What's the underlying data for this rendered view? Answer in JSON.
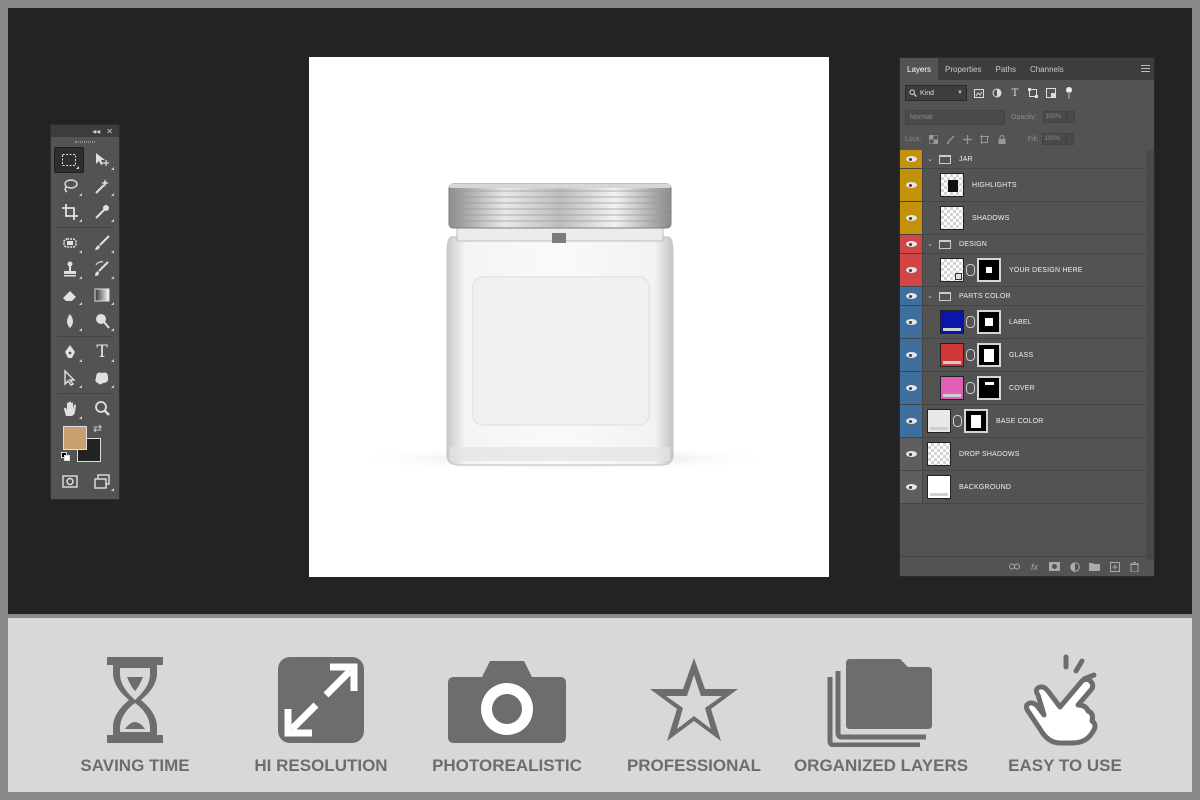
{
  "colors": {
    "workspace": "#232323",
    "panel": "#535353",
    "group_jar": "#c4920a",
    "group_design": "#d04646",
    "group_parts": "#3e6e9c",
    "group_default": "#5e5e5e",
    "feature_gray": "#6d6d6d",
    "foreground_swatch": "#c8a070",
    "background_swatch": "#222222"
  },
  "toolbox": {
    "collapse_glyph": "◂◂",
    "close_glyph": "✕",
    "tools": [
      [
        "marquee-icon",
        "move-icon"
      ],
      [
        "lasso-icon",
        "magic-wand-icon"
      ],
      [
        "crop-icon",
        "eyedropper-icon"
      ],
      [
        "healing-brush-icon",
        "brush-icon"
      ],
      [
        "clone-stamp-icon",
        "history-brush-icon"
      ],
      [
        "eraser-icon",
        "gradient-icon"
      ],
      [
        "blur-icon",
        "dodge-icon"
      ],
      [
        "pen-icon",
        "type-icon"
      ],
      [
        "path-selection-icon",
        "custom-shape-icon"
      ],
      [
        "hand-icon",
        "zoom-icon"
      ]
    ],
    "type_tool_glyph": "T",
    "swap_glyph": "⇄"
  },
  "layers_panel": {
    "tabs": [
      "Layers",
      "Properties",
      "Paths",
      "Channels"
    ],
    "active_tab": "Layers",
    "filter_kind": "Kind",
    "blend_mode": "Normal",
    "opacity_label": "Opacity:",
    "opacity_value": "100%",
    "lock_label": "Lock:",
    "fill_label": "Fill:",
    "fill_value": "100%",
    "fx_label": "fx",
    "layers": [
      {
        "name": "JAR",
        "type": "group",
        "indent": 0,
        "color": "group_jar"
      },
      {
        "name": "HIGHLIGHTS",
        "type": "layer",
        "indent": 1,
        "color": "group_jar",
        "thumb": "checker-dark",
        "mask": false
      },
      {
        "name": "SHADOWS",
        "type": "layer",
        "indent": 1,
        "color": "group_jar",
        "thumb": "checker",
        "mask": false
      },
      {
        "name": "DESIGN",
        "type": "group",
        "indent": 0,
        "color": "group_design"
      },
      {
        "name": "YOUR DESIGN HERE",
        "type": "layer",
        "indent": 1,
        "color": "group_design",
        "thumb": "checker-smart",
        "mask": true
      },
      {
        "name": "PARTS COLOR",
        "type": "group",
        "indent": 0,
        "color": "group_parts"
      },
      {
        "name": "LABEL",
        "type": "layer",
        "indent": 1,
        "color": "group_parts",
        "thumb": "#0a16a8",
        "mask": true
      },
      {
        "name": "GLASS",
        "type": "layer",
        "indent": 1,
        "color": "group_parts",
        "thumb": "#d23838",
        "mask": true
      },
      {
        "name": "COVER",
        "type": "layer",
        "indent": 1,
        "color": "group_parts",
        "thumb": "#e060b8",
        "mask": true
      },
      {
        "name": "BASE COLOR",
        "type": "layer",
        "indent": 0,
        "color": "group_parts",
        "thumb": "#e8e8e8",
        "mask": true
      },
      {
        "name": "DROP SHADOWS",
        "type": "layer",
        "indent": 0,
        "color": "group_default",
        "thumb": "checker",
        "mask": false
      },
      {
        "name": "BACKGROUND",
        "type": "layer",
        "indent": 0,
        "color": "group_default",
        "thumb": "#ffffff",
        "mask": false
      }
    ]
  },
  "features": [
    {
      "icon": "hourglass-icon",
      "label": "SAVING TIME"
    },
    {
      "icon": "resize-arrows-icon",
      "label": "HI RESOLUTION"
    },
    {
      "icon": "camera-icon",
      "label": "PHOTOREALISTIC"
    },
    {
      "icon": "star-icon",
      "label": "PROFESSIONAL"
    },
    {
      "icon": "stacked-folders-icon",
      "label": "ORGANIZED LAYERS"
    },
    {
      "icon": "hand-pointer-icon",
      "label": "EASY TO USE"
    }
  ]
}
